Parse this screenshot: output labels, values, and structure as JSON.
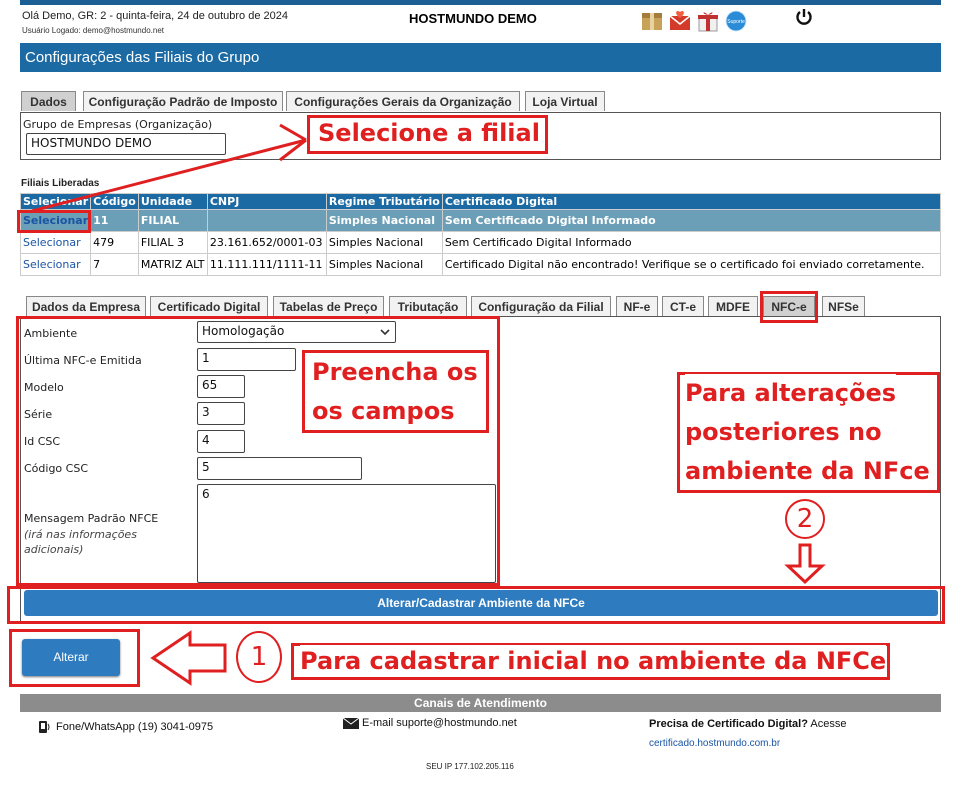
{
  "header": {
    "greeting": "Olá Demo, GR: 2 - quinta-feira, 24 de outubro de 2024",
    "user_logged": "Usuário Logado: demo@hostmundo.net",
    "brand": "HOSTMUNDO DEMO",
    "icons": [
      "box-icon",
      "heart-mail-icon",
      "gift-icon",
      "support-globe-icon"
    ],
    "support_icon_text": "Suporte",
    "power_icon": "power-icon"
  },
  "banner": {
    "title": "Configurações das Filiais do Grupo"
  },
  "top_tabs": [
    "Dados",
    "Configuração Padrão de Imposto",
    "Configurações Gerais da Organização",
    "Loja Virtual"
  ],
  "group": {
    "label": "Grupo de Empresas (Organização)",
    "value": "HOSTMUNDO DEMO"
  },
  "filiais": {
    "title": "Filiais Liberadas",
    "columns": [
      "Selecionar",
      "Código",
      "Unidade",
      "CNPJ",
      "Regime Tributário",
      "Certificado Digital"
    ],
    "rows": [
      {
        "select": "Selecionar",
        "code": "11",
        "unit": "FILIAL",
        "cnpj": "",
        "regime": "Simples Nacional",
        "cert": "Sem Certificado Digital Informado"
      },
      {
        "select": "Selecionar",
        "code": "479",
        "unit": "FILIAL 3",
        "cnpj": "23.161.652/0001-03",
        "regime": "Simples Nacional",
        "cert": "Sem Certificado Digital Informado"
      },
      {
        "select": "Selecionar",
        "code": "7",
        "unit": "MATRIZ ALT",
        "cnpj": "11.111.111/1111-11",
        "regime": "Simples Nacional",
        "cert": "Certificado Digital não encontrado! Verifique se o certificado foi enviado corretamente."
      }
    ]
  },
  "sub_tabs": [
    "Dados da Empresa",
    "Certificado Digital",
    "Tabelas de Preço",
    "Tributação",
    "Configuração da Filial",
    "NF-e",
    "CT-e",
    "MDFE",
    "NFC-e",
    "NFSe"
  ],
  "form": {
    "ambiente_label": "Ambiente",
    "ambiente_value": "Homologação",
    "ultima_label": "Última NFC-e Emitida",
    "ultima_value": "1",
    "modelo_label": "Modelo",
    "modelo_value": "65",
    "serie_label": "Série",
    "serie_value": "3",
    "idcsc_label": "Id CSC",
    "idcsc_value": "4",
    "codcsc_label": "Código CSC",
    "codcsc_value": "5",
    "msg_label": "Mensagem Padrão NFCE",
    "msg_hint": "(irá nas informações adicionais)",
    "msg_value": "6"
  },
  "buttons": {
    "alterar_cadastrar": "Alterar/Cadastrar Ambiente da NFCe",
    "alterar": "Alterar"
  },
  "annotations": {
    "select_branch": "Selecione a filial",
    "fill_fields_1": "Preencha os",
    "fill_fields_2": "os campos",
    "later_1": "Para alterações",
    "later_2": "posteriores no",
    "later_3": "ambiente da NFce",
    "step2": "2",
    "step1": "1",
    "initial": "Para cadastrar inicial no ambiente da NFCe"
  },
  "footer": {
    "title": "Canais de Atendimento",
    "phone": "Fone/WhatsApp (19) 3041-0975",
    "email": "E-mail suporte@hostmundo.net",
    "cert_q": "Precisa de Certificado Digital?",
    "cert_a": "Acesse",
    "cert_link": "certificado.hostmundo.com.br",
    "ip": "SEU IP 177.102.205.116"
  },
  "colors": {
    "blue": "#1c6aa3",
    "red": "#e02020",
    "button": "#2e7bbf"
  }
}
